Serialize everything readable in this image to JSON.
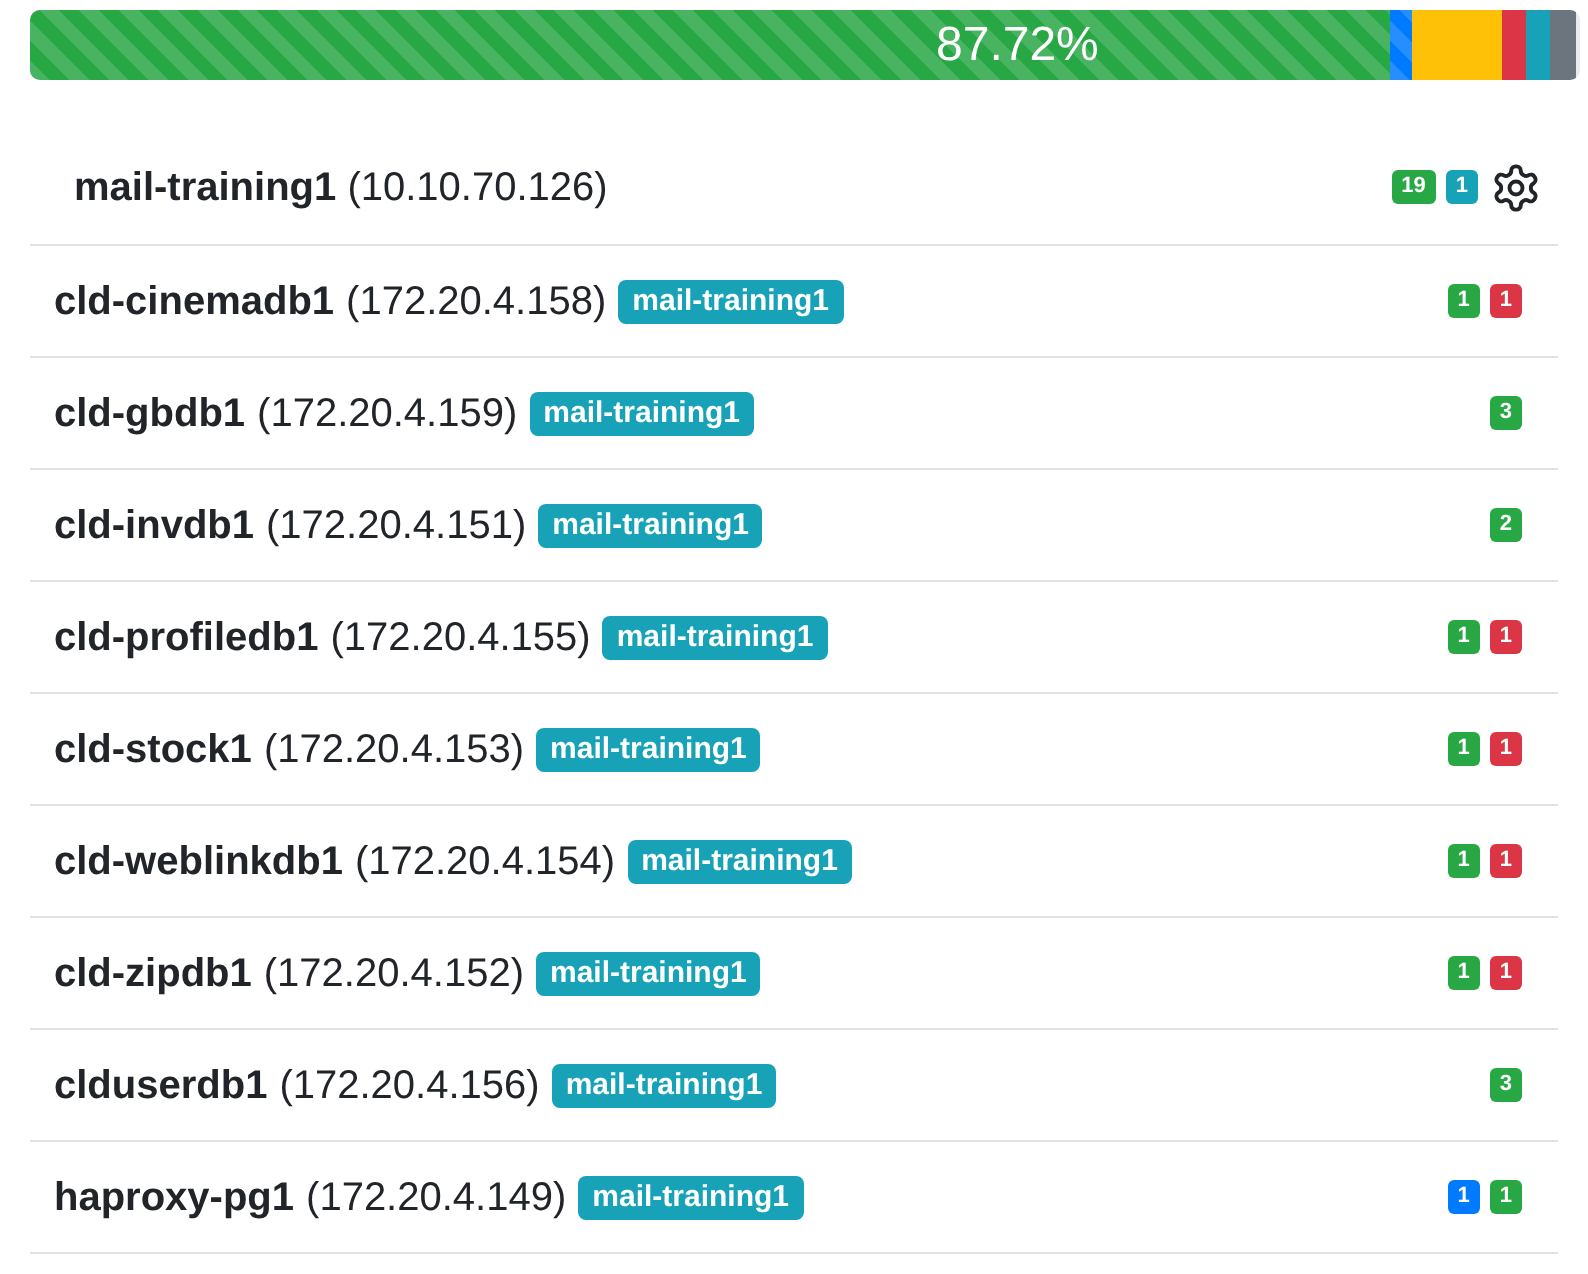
{
  "progress": {
    "label": "87.72%",
    "segments": [
      {
        "level": 0.8772,
        "color": "#28a745",
        "striped": true
      },
      {
        "color": "#007bff",
        "striped": true
      },
      {
        "color": "#ffc107",
        "striped": false
      },
      {
        "color": "#dc3545",
        "striped": false
      },
      {
        "color": "#17a2b8",
        "striped": false
      },
      {
        "level": 0.0178,
        "color": "#6c757d",
        "striped": false
      }
    ]
  },
  "host": {
    "name": "mail-training1",
    "ip": "(10.10.70.126)",
    "badges": [
      {
        "text": "19",
        "color": "#28a745"
      },
      {
        "text": "1",
        "color": "#17a2b8"
      }
    ]
  },
  "rows": [
    {
      "name": "cld-cinemadb1",
      "ip": "(172.20.4.158)",
      "tag": "mail-training1",
      "badges": [
        {
          "text": "1",
          "color": "#28a745"
        },
        {
          "text": "1",
          "color": "#dc3545"
        }
      ]
    },
    {
      "name": "cld-gbdb1",
      "ip": "(172.20.4.159)",
      "tag": "mail-training1",
      "badges": [
        {
          "text": "3",
          "color": "#28a745"
        }
      ]
    },
    {
      "name": "cld-invdb1",
      "ip": "(172.20.4.151)",
      "tag": "mail-training1",
      "badges": [
        {
          "text": "2",
          "color": "#28a745"
        }
      ]
    },
    {
      "name": "cld-profiledb1",
      "ip": "(172.20.4.155)",
      "tag": "mail-training1",
      "badges": [
        {
          "text": "1",
          "color": "#28a745"
        },
        {
          "text": "1",
          "color": "#dc3545"
        }
      ]
    },
    {
      "name": "cld-stock1",
      "ip": "(172.20.4.153)",
      "tag": "mail-training1",
      "badges": [
        {
          "text": "1",
          "color": "#28a745"
        },
        {
          "text": "1",
          "color": "#dc3545"
        }
      ]
    },
    {
      "name": "cld-weblinkdb1",
      "ip": "(172.20.4.154)",
      "tag": "mail-training1",
      "badges": [
        {
          "text": "1",
          "color": "#28a745"
        },
        {
          "text": "1",
          "color": "#dc3545"
        }
      ]
    },
    {
      "name": "cld-zipdb1",
      "ip": "(172.20.4.152)",
      "tag": "mail-training1",
      "badges": [
        {
          "text": "1",
          "color": "#28a745"
        },
        {
          "text": "1",
          "color": "#dc3545"
        }
      ]
    },
    {
      "name": "clduserdb1",
      "ip": "(172.20.4.156)",
      "tag": "mail-training1",
      "badges": [
        {
          "text": "3",
          "color": "#28a745"
        }
      ]
    },
    {
      "name": "haproxy-pg1",
      "ip": "(172.20.4.149)",
      "tag": "mail-training1",
      "badges": [
        {
          "text": "1",
          "color": "#007bff"
        },
        {
          "text": "1",
          "color": "#28a745"
        }
      ]
    }
  ]
}
